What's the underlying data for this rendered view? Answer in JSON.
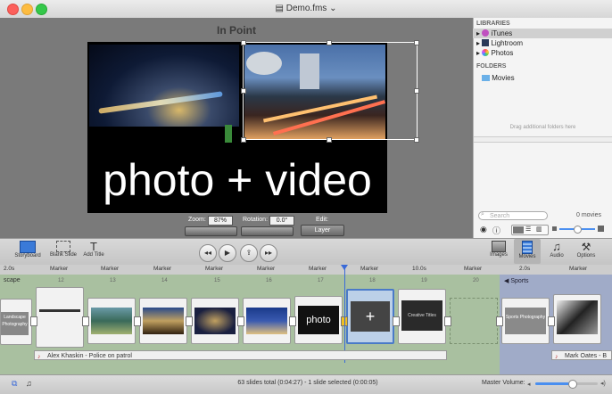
{
  "window": {
    "title": "Demo.fms"
  },
  "preview": {
    "heading": "In Point",
    "overlay_text": "photo + video",
    "zoom_label": "Zoom:",
    "zoom_value": "87%",
    "rotation_label": "Rotation:",
    "rotation_value": "0.0°",
    "edit_label": "Edit:",
    "layer_button": "Layer"
  },
  "library": {
    "libraries_heading": "LIBRARIES",
    "items": [
      "iTunes",
      "Lightroom",
      "Photos"
    ],
    "folders_heading": "FOLDERS",
    "folders": [
      "Movies"
    ],
    "drag_hint": "Drag additional folders here",
    "search_placeholder": "Search",
    "count": "0 movies"
  },
  "toolbar": {
    "storyboard": "Storyboard",
    "blank_slide": "Blank Slide",
    "add_title": "Add Title",
    "images": "Images",
    "movies": "Movies",
    "audio": "Audio",
    "options": "Options"
  },
  "ruler": {
    "labels": [
      "2.0s",
      "Marker",
      "Marker",
      "Marker",
      "Marker",
      "Marker",
      "10.0s",
      "Marker",
      "2.0s",
      "Marker"
    ]
  },
  "timeline": {
    "left_section": "scape",
    "right_section": "◀ Sports",
    "slide_numbers": [
      "12",
      "13",
      "14",
      "15",
      "16",
      "17",
      "18",
      "19",
      "20"
    ],
    "slide_captions": [
      "Landscape Photography",
      "Creative Titles",
      "Sports Photography"
    ],
    "audio_left": "Alex Khaskin - Police on patrol",
    "audio_right": "Mark Oates - B"
  },
  "status": {
    "summary": "63 slides total (0:04:27)  -  1 slide selected (0:00:05)",
    "volume_label": "Master Volume:"
  }
}
